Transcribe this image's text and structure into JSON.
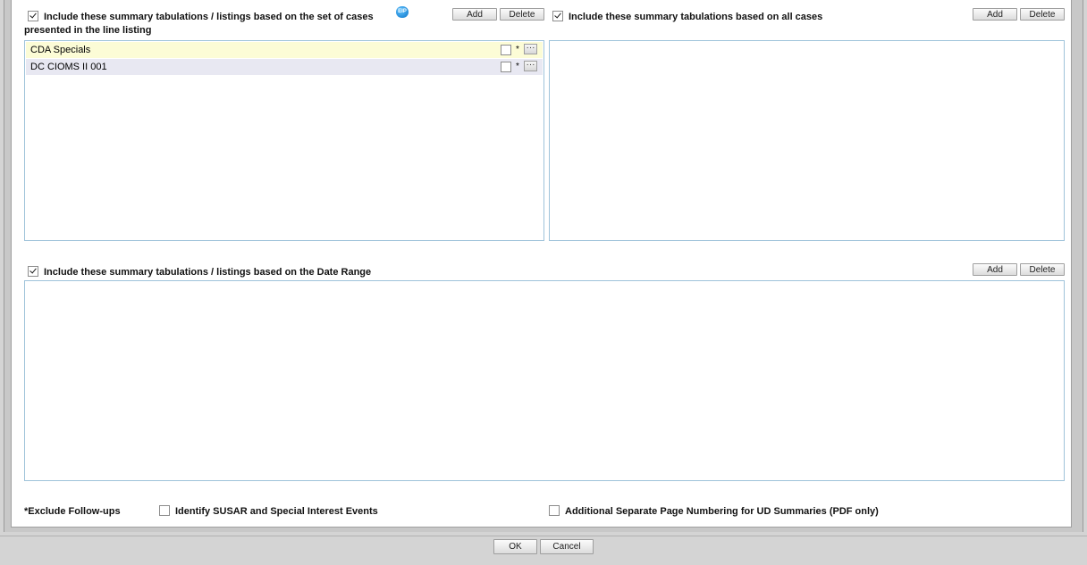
{
  "section_line_listing": {
    "checked": true,
    "label_line1": "Include these summary tabulations / listings based on the set of cases",
    "label_line2": "presented in the line listing",
    "info_icon": "info-icon",
    "add_label": "Add",
    "delete_label": "Delete",
    "rows": [
      {
        "name": "CDA Specials",
        "star": "*",
        "dots": "···"
      },
      {
        "name": "DC CIOMS II 001",
        "star": "*",
        "dots": "···"
      }
    ]
  },
  "section_all_cases": {
    "checked": true,
    "label": "Include these summary tabulations based on all cases",
    "add_label": "Add",
    "delete_label": "Delete"
  },
  "section_date_range": {
    "checked": true,
    "label": "Include these summary tabulations / listings based on the Date Range",
    "add_label": "Add",
    "delete_label": "Delete"
  },
  "footer": {
    "exclude_followups": "*Exclude Follow-ups",
    "identify_susar": "Identify SUSAR and Special Interest Events",
    "additional_numbering": "Additional Separate Page Numbering for UD Summaries (PDF only)"
  },
  "buttons": {
    "ok": "OK",
    "cancel": "Cancel"
  },
  "colors": {
    "row_highlight": "#fcfcd6",
    "row_selected": "#e8e8f2",
    "listbox_border": "#9fc3da"
  }
}
